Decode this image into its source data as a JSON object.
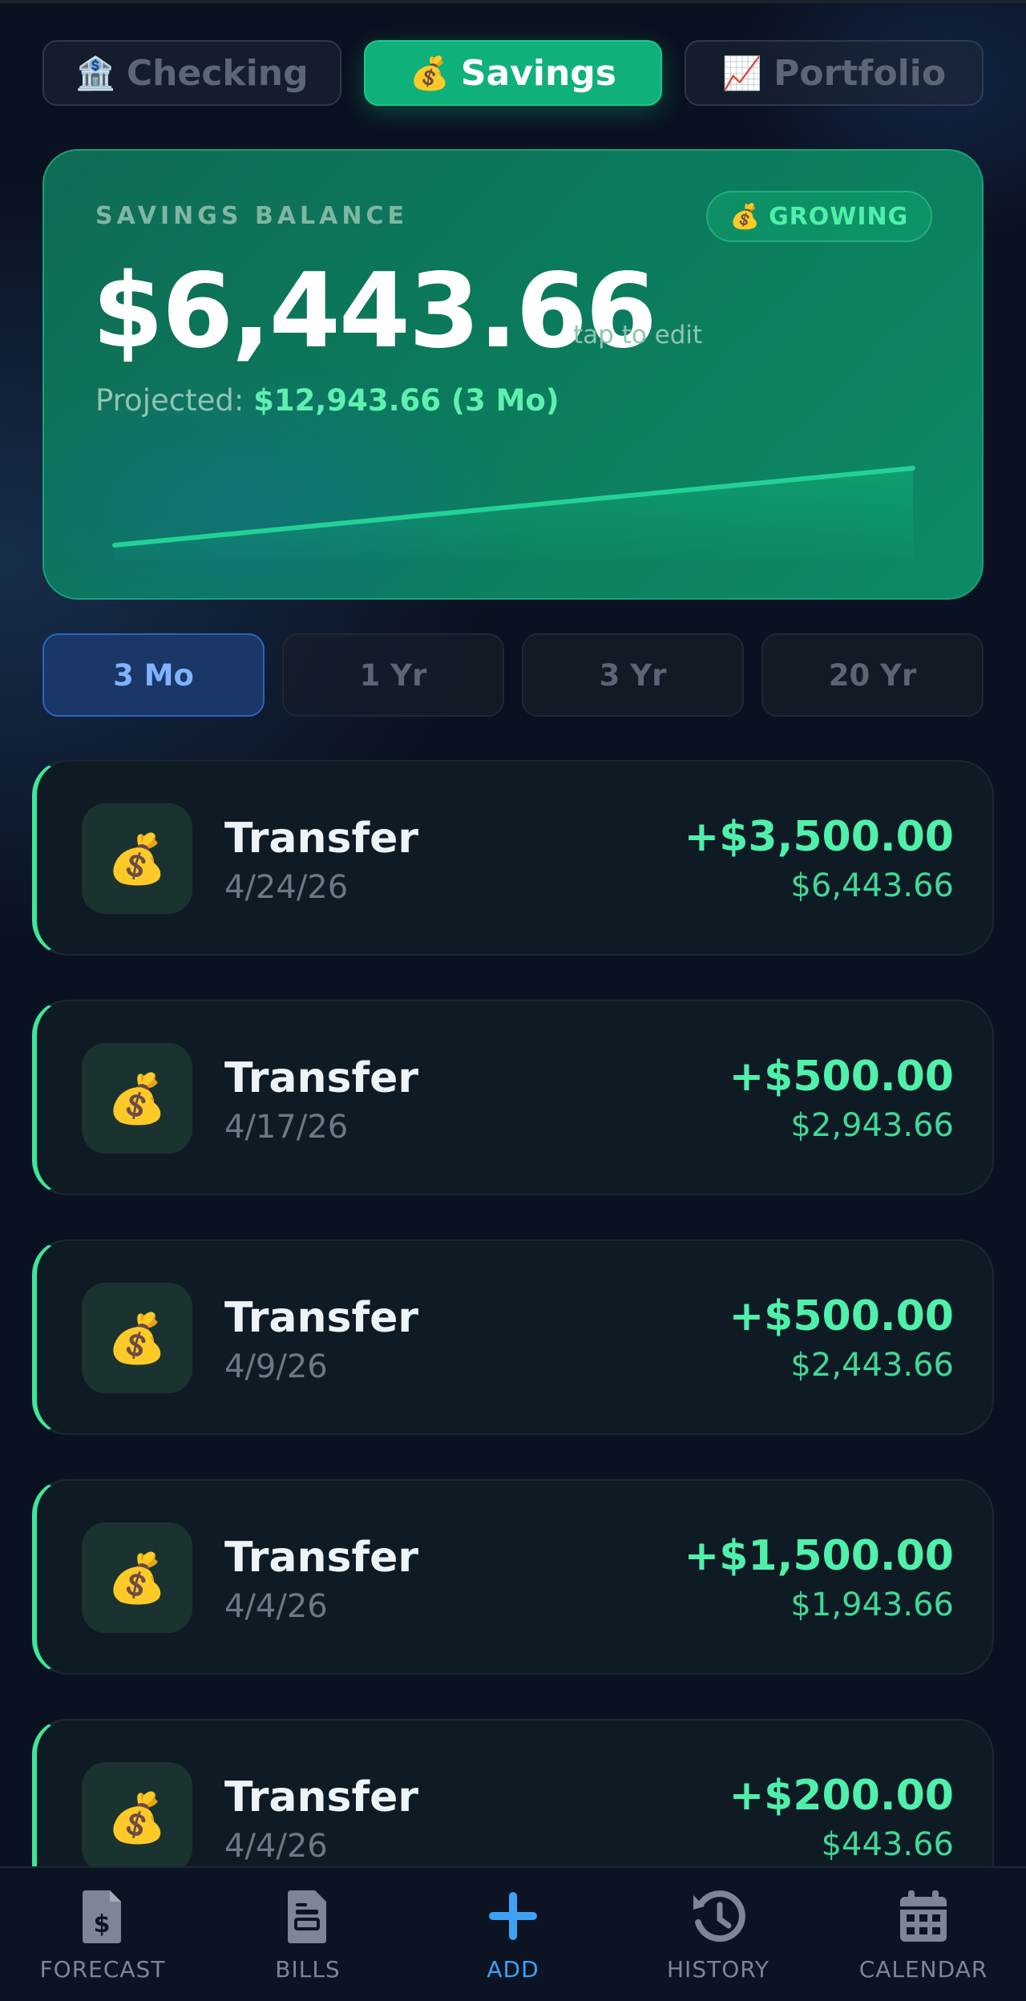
{
  "account_tabs": [
    {
      "icon": "🏦",
      "label": "Checking",
      "active": false
    },
    {
      "icon": "💰",
      "label": "Savings",
      "active": true
    },
    {
      "icon": "📈",
      "label": "Portfolio",
      "active": false
    }
  ],
  "balance_card": {
    "label": "SAVINGS BALANCE",
    "badge_icon": "💰",
    "badge_label": "GROWING",
    "amount": "$6,443.66",
    "edit_hint": "tap to edit",
    "projected_label": "Projected:",
    "projected_value": "$12,943.66 (3 Mo)"
  },
  "range_tabs": [
    {
      "label": "3 Mo",
      "active": true
    },
    {
      "label": "1 Yr",
      "active": false
    },
    {
      "label": "3 Yr",
      "active": false
    },
    {
      "label": "20 Yr",
      "active": false
    }
  ],
  "transactions": [
    {
      "icon": "💰",
      "title": "Transfer",
      "date": "4/24/26",
      "amount": "+$3,500.00",
      "running_balance": "$6,443.66"
    },
    {
      "icon": "💰",
      "title": "Transfer",
      "date": "4/17/26",
      "amount": "+$500.00",
      "running_balance": "$2,943.66"
    },
    {
      "icon": "💰",
      "title": "Transfer",
      "date": "4/9/26",
      "amount": "+$500.00",
      "running_balance": "$2,443.66"
    },
    {
      "icon": "💰",
      "title": "Transfer",
      "date": "4/4/26",
      "amount": "+$1,500.00",
      "running_balance": "$1,943.66"
    },
    {
      "icon": "💰",
      "title": "Transfer",
      "date": "4/4/26",
      "amount": "+$200.00",
      "running_balance": "$443.66"
    }
  ],
  "bottom_nav": [
    {
      "icon": "forecast-icon",
      "label": "FORECAST",
      "active": false
    },
    {
      "icon": "bills-icon",
      "label": "BILLS",
      "active": false
    },
    {
      "icon": "add-icon",
      "label": "ADD",
      "active": true
    },
    {
      "icon": "history-icon",
      "label": "HISTORY",
      "active": false
    },
    {
      "icon": "calendar-icon",
      "label": "CALENDAR",
      "active": false
    }
  ],
  "colors": {
    "accent_green": "#10b07a",
    "positive": "#4ff0aa",
    "active_blue": "#3ea1f5",
    "background": "#0a1120"
  }
}
